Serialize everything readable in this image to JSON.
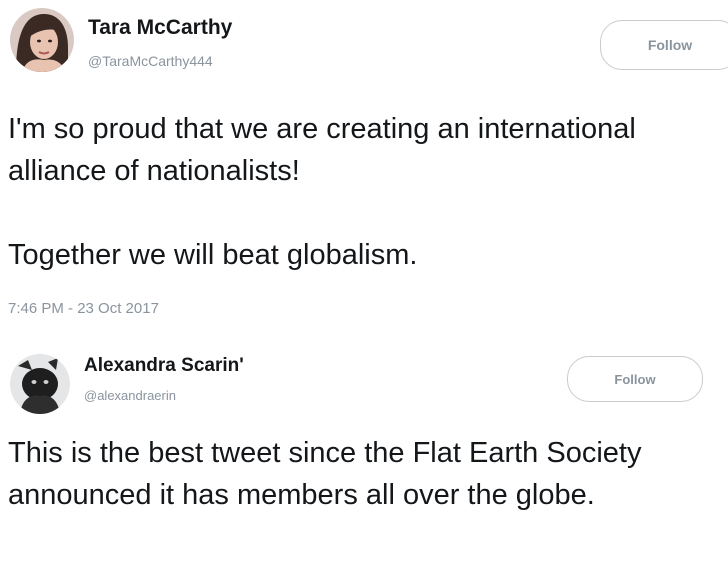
{
  "tweets": [
    {
      "display_name": "Tara McCarthy",
      "handle": "@TaraMcCarthy444",
      "follow_label": "Follow",
      "text_paragraphs": [
        "I'm so proud that we are creating an international alliance of nationalists!",
        "Together we will beat globalism."
      ],
      "timestamp": "7:46 PM - 23 Oct 2017"
    },
    {
      "display_name": "Alexandra Scarin'",
      "handle": "@alexandraerin",
      "follow_label": "Follow",
      "text_paragraphs": [
        "This is the best tweet since the Flat Earth Society announced it has members all over the globe."
      ]
    }
  ],
  "colors": {
    "text": "#14171a",
    "secondary_text": "#8a949e",
    "button_border": "#c8ccd0",
    "background": "#ffffff"
  }
}
